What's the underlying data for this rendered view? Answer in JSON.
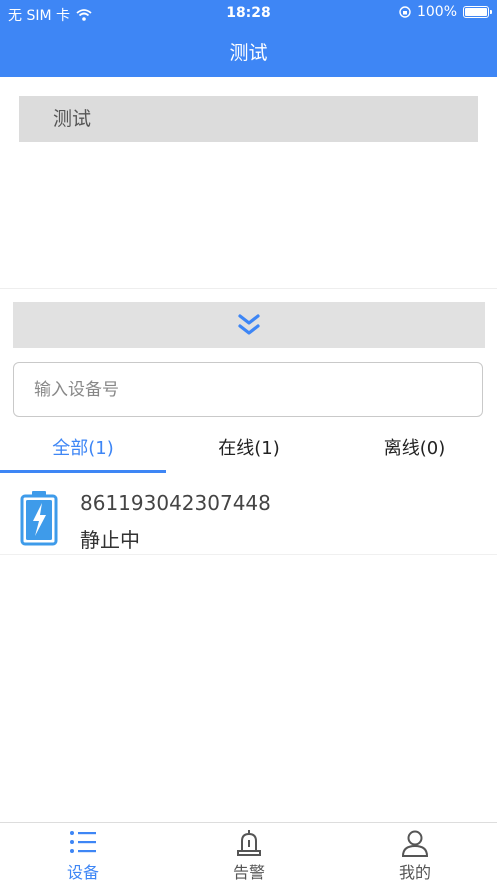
{
  "status": {
    "carrier": "无 SIM 卡",
    "time": "18:28",
    "battery": "100%"
  },
  "nav": {
    "title": "测试"
  },
  "panel": {
    "label": "测试"
  },
  "search": {
    "placeholder": "输入设备号"
  },
  "tabs": [
    {
      "label": "全部(1)",
      "active": true
    },
    {
      "label": "在线(1)",
      "active": false
    },
    {
      "label": "离线(0)",
      "active": false
    }
  ],
  "devices": [
    {
      "id": "861193042307448",
      "state": "静止中",
      "icon": "battery-charging-icon"
    }
  ],
  "tabbar": [
    {
      "label": "设备",
      "icon": "list-icon",
      "active": true
    },
    {
      "label": "告警",
      "icon": "alarm-icon",
      "active": false
    },
    {
      "label": "我的",
      "icon": "user-icon",
      "active": false
    }
  ],
  "colors": {
    "primary": "#3e86f5",
    "panel_gray": "#dcdcdc",
    "bar_gray": "#e1e1e1"
  }
}
